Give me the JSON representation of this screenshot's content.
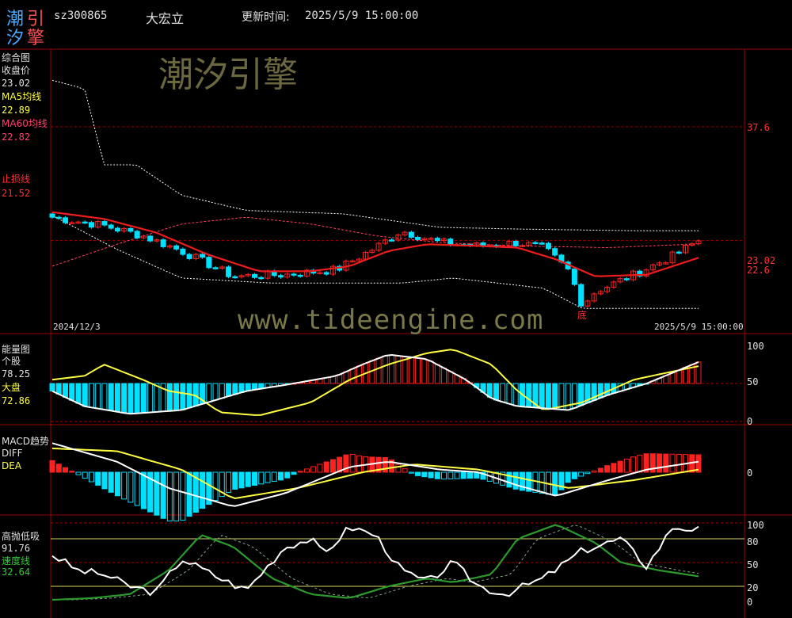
{
  "header": {
    "logo_chars": [
      "潮",
      "引",
      "汐",
      "擎"
    ],
    "code": "sz300865",
    "name": "大宏立",
    "update_label": "更新时间:",
    "update_time": "2025/5/9 15:00:00"
  },
  "watermarks": {
    "brand": "潮汐引擎",
    "url": "www.tideengine.com"
  },
  "colors": {
    "up": "#ff2020",
    "down": "#00e0ff",
    "ma5": "#ffff40",
    "ma60": "#ff4070",
    "grid": "#9a0000",
    "bg": "#000000"
  },
  "panels": {
    "main": {
      "title": "综合图",
      "close_label": "收盘价",
      "close_value": "23.02",
      "ma5_label": "MA5均线",
      "ma5_value": "22.89",
      "ma60_label": "MA60均线",
      "ma60_value": "22.82",
      "stop_label": "止损线",
      "stop_value": "21.52",
      "date_start": "2024/12/3",
      "date_end": "2025/5/9 15:00:00",
      "bottom_marker": "底",
      "axis_labels": [
        "37.6",
        "23.02",
        "22.6"
      ]
    },
    "energy": {
      "title": "能量图",
      "stock_label": "个股",
      "stock_value": "78.25",
      "market_label": "大盘",
      "market_value": "72.86",
      "axis_labels": [
        "100",
        "50",
        "0"
      ]
    },
    "macd": {
      "title": "MACD趋势",
      "diff_label": "DIFF",
      "dea_label": "DEA",
      "axis_labels": [
        "0"
      ]
    },
    "osc": {
      "title": "高抛低吸",
      "value1": "91.76",
      "speed_label": "速度线",
      "speed_value": "32.64",
      "axis_labels": [
        "100",
        "80",
        "50",
        "20",
        "0"
      ]
    }
  },
  "chart_data": [
    {
      "type": "candlestick",
      "title": "综合图",
      "n": 100,
      "close_anchors": [
        [
          0,
          24.4
        ],
        [
          8,
          23.9
        ],
        [
          14,
          23.3
        ],
        [
          20,
          22.4
        ],
        [
          28,
          20.9
        ],
        [
          36,
          21.0
        ],
        [
          44,
          21.3
        ],
        [
          50,
          22.6
        ],
        [
          54,
          23.6
        ],
        [
          60,
          22.9
        ],
        [
          66,
          22.7
        ],
        [
          72,
          22.9
        ],
        [
          76,
          22.6
        ],
        [
          80,
          21.2
        ],
        [
          82,
          19.2
        ],
        [
          84,
          20.0
        ],
        [
          90,
          21.0
        ],
        [
          96,
          22.1
        ],
        [
          100,
          23.02
        ]
      ],
      "ma5_anchors": [
        [
          0,
          24.7
        ],
        [
          8,
          24.3
        ],
        [
          16,
          23.5
        ],
        [
          24,
          22.2
        ],
        [
          32,
          21.2
        ],
        [
          40,
          21.2
        ],
        [
          46,
          21.5
        ],
        [
          52,
          22.4
        ],
        [
          58,
          22.8
        ],
        [
          66,
          22.7
        ],
        [
          72,
          22.6
        ],
        [
          78,
          21.9
        ],
        [
          84,
          20.9
        ],
        [
          92,
          21.0
        ],
        [
          100,
          22.0
        ]
      ],
      "ma60_anchors": [
        [
          0,
          21.5
        ],
        [
          10,
          22.8
        ],
        [
          20,
          24.0
        ],
        [
          30,
          24.4
        ],
        [
          40,
          24.0
        ],
        [
          50,
          23.3
        ],
        [
          60,
          22.9
        ],
        [
          72,
          22.7
        ],
        [
          86,
          22.6
        ],
        [
          100,
          22.82
        ]
      ],
      "upper_anchors": [
        [
          0,
          32.5
        ],
        [
          5,
          32.0
        ],
        [
          8,
          27.5
        ],
        [
          13,
          27.5
        ],
        [
          20,
          25.7
        ],
        [
          30,
          24.8
        ],
        [
          45,
          24.6
        ],
        [
          60,
          23.8
        ],
        [
          72,
          23.7
        ],
        [
          90,
          23.6
        ],
        [
          100,
          23.6
        ]
      ],
      "lower_anchors": [
        [
          0,
          24.5
        ],
        [
          10,
          22.5
        ],
        [
          20,
          20.8
        ],
        [
          34,
          20.5
        ],
        [
          54,
          20.5
        ],
        [
          62,
          20.8
        ],
        [
          76,
          20.2
        ],
        [
          82,
          19.0
        ],
        [
          100,
          19.0
        ]
      ],
      "stop_level": 21.52,
      "ylim": [
        18.5,
        33.5
      ]
    },
    {
      "type": "bar+line",
      "title": "能量图",
      "ylim": [
        0,
        100
      ],
      "series": [
        {
          "name": "个股"
        },
        {
          "name": "大盘"
        }
      ],
      "stock_anchors": [
        [
          0,
          40
        ],
        [
          5,
          20
        ],
        [
          12,
          10
        ],
        [
          20,
          15
        ],
        [
          26,
          30
        ],
        [
          30,
          40
        ],
        [
          36,
          48
        ],
        [
          44,
          60
        ],
        [
          48,
          75
        ],
        [
          52,
          88
        ],
        [
          58,
          82
        ],
        [
          64,
          55
        ],
        [
          68,
          30
        ],
        [
          72,
          20
        ],
        [
          80,
          15
        ],
        [
          86,
          35
        ],
        [
          92,
          50
        ],
        [
          100,
          78.25
        ]
      ],
      "market_anchors": [
        [
          0,
          55
        ],
        [
          5,
          60
        ],
        [
          8,
          75
        ],
        [
          14,
          55
        ],
        [
          18,
          40
        ],
        [
          22,
          35
        ],
        [
          26,
          12
        ],
        [
          32,
          8
        ],
        [
          40,
          25
        ],
        [
          46,
          55
        ],
        [
          52,
          75
        ],
        [
          58,
          90
        ],
        [
          62,
          95
        ],
        [
          68,
          75
        ],
        [
          72,
          40
        ],
        [
          76,
          15
        ],
        [
          82,
          25
        ],
        [
          90,
          55
        ],
        [
          100,
          72.86
        ]
      ]
    },
    {
      "type": "macd",
      "title": "MACD趋势",
      "series": [
        {
          "name": "DIFF"
        },
        {
          "name": "DEA"
        }
      ],
      "diff_anchors": [
        [
          0,
          0.55
        ],
        [
          10,
          0.2
        ],
        [
          18,
          -0.3
        ],
        [
          28,
          -0.65
        ],
        [
          36,
          -0.4
        ],
        [
          46,
          0.1
        ],
        [
          52,
          0.2
        ],
        [
          60,
          0.05
        ],
        [
          66,
          0.0
        ],
        [
          72,
          -0.25
        ],
        [
          78,
          -0.45
        ],
        [
          86,
          -0.15
        ],
        [
          92,
          0.05
        ],
        [
          100,
          0.2
        ]
      ],
      "dea_anchors": [
        [
          0,
          0.45
        ],
        [
          10,
          0.4
        ],
        [
          20,
          0.05
        ],
        [
          28,
          -0.5
        ],
        [
          38,
          -0.3
        ],
        [
          48,
          0.0
        ],
        [
          56,
          0.15
        ],
        [
          66,
          0.05
        ],
        [
          72,
          -0.1
        ],
        [
          80,
          -0.3
        ],
        [
          90,
          -0.15
        ],
        [
          100,
          0.05
        ]
      ],
      "ylim": [
        -0.75,
        0.6
      ]
    },
    {
      "type": "line",
      "title": "高抛低吸",
      "ylim": [
        0,
        100
      ],
      "series": [
        {
          "name": "高抛低吸"
        },
        {
          "name": "速度线"
        }
      ],
      "fast_anchors": [
        [
          0,
          60
        ],
        [
          4,
          40
        ],
        [
          8,
          35
        ],
        [
          12,
          20
        ],
        [
          16,
          12
        ],
        [
          20,
          55
        ],
        [
          26,
          30
        ],
        [
          30,
          15
        ],
        [
          36,
          70
        ],
        [
          40,
          80
        ],
        [
          42,
          60
        ],
        [
          46,
          95
        ],
        [
          50,
          85
        ],
        [
          54,
          40
        ],
        [
          58,
          25
        ],
        [
          62,
          50
        ],
        [
          66,
          20
        ],
        [
          70,
          10
        ],
        [
          76,
          30
        ],
        [
          82,
          65
        ],
        [
          88,
          80
        ],
        [
          92,
          45
        ],
        [
          96,
          95
        ],
        [
          100,
          91.76
        ]
      ],
      "slow_anchors": [
        [
          0,
          3
        ],
        [
          6,
          5
        ],
        [
          12,
          10
        ],
        [
          18,
          40
        ],
        [
          23,
          85
        ],
        [
          28,
          70
        ],
        [
          34,
          30
        ],
        [
          40,
          10
        ],
        [
          46,
          5
        ],
        [
          52,
          20
        ],
        [
          58,
          30
        ],
        [
          62,
          25
        ],
        [
          68,
          35
        ],
        [
          72,
          80
        ],
        [
          78,
          98
        ],
        [
          84,
          75
        ],
        [
          88,
          50
        ],
        [
          94,
          40
        ],
        [
          100,
          32.64
        ]
      ]
    }
  ]
}
